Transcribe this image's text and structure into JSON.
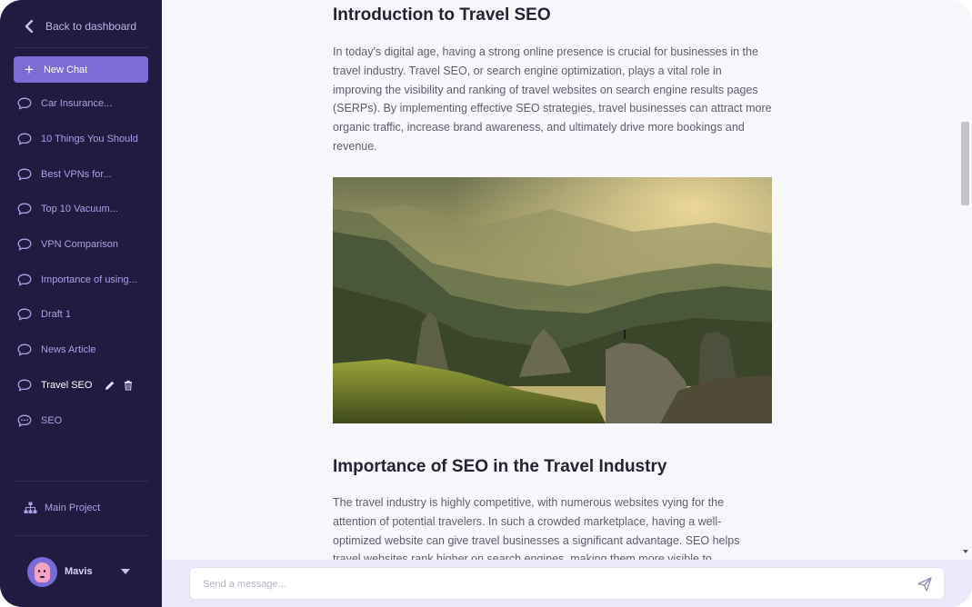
{
  "sidebar": {
    "back_label": "Back to dashboard",
    "new_chat_label": "New Chat",
    "chats": [
      {
        "label": "Car Insurance...",
        "active": false
      },
      {
        "label": "10 Things You Should",
        "active": false
      },
      {
        "label": "Best VPNs for...",
        "active": false
      },
      {
        "label": "Top 10 Vacuum...",
        "active": false
      },
      {
        "label": "VPN Comparison",
        "active": false
      },
      {
        "label": "Importance of using...",
        "active": false
      },
      {
        "label": "Draft 1",
        "active": false
      },
      {
        "label": "News Article",
        "active": false
      },
      {
        "label": "Travel SEO",
        "active": true
      },
      {
        "label": "SEO",
        "active": false
      }
    ],
    "project_label": "Main Project",
    "user_name": "Mavis"
  },
  "article": {
    "heading1": "Introduction to Travel SEO",
    "paragraph1": "In today's digital age, having a strong online presence is crucial for businesses in the travel industry. Travel SEO, or search engine optimization, plays a vital role in improving the visibility and ranking of travel websites on search engine results pages (SERPs). By implementing effective SEO strategies, travel businesses can attract more organic traffic, increase brand awareness, and ultimately drive more bookings and revenue.",
    "heading2": "Importance of SEO in the Travel Industry",
    "paragraph2": "The travel industry is highly competitive, with numerous websites vying for the attention of potential travelers. In such a crowded marketplace, having a well-optimized website can give travel businesses a significant advantage. SEO helps travel websites rank higher on search engines, making them more visible to users."
  },
  "composer": {
    "placeholder": "Send a message..."
  },
  "icons": {
    "back": "chevron-left-icon",
    "new_chat": "plus-icon",
    "chat": "chat-bubble-icon",
    "active_chat": "chat-dots-icon",
    "edit": "pencil-icon",
    "delete": "trash-icon",
    "project": "sitemap-icon",
    "user_menu": "caret-down-icon",
    "send": "send-icon"
  },
  "colors": {
    "sidebar_bg": "#211b41",
    "accent": "#7e6cd6",
    "composer_bar": "#ebe8fb"
  }
}
